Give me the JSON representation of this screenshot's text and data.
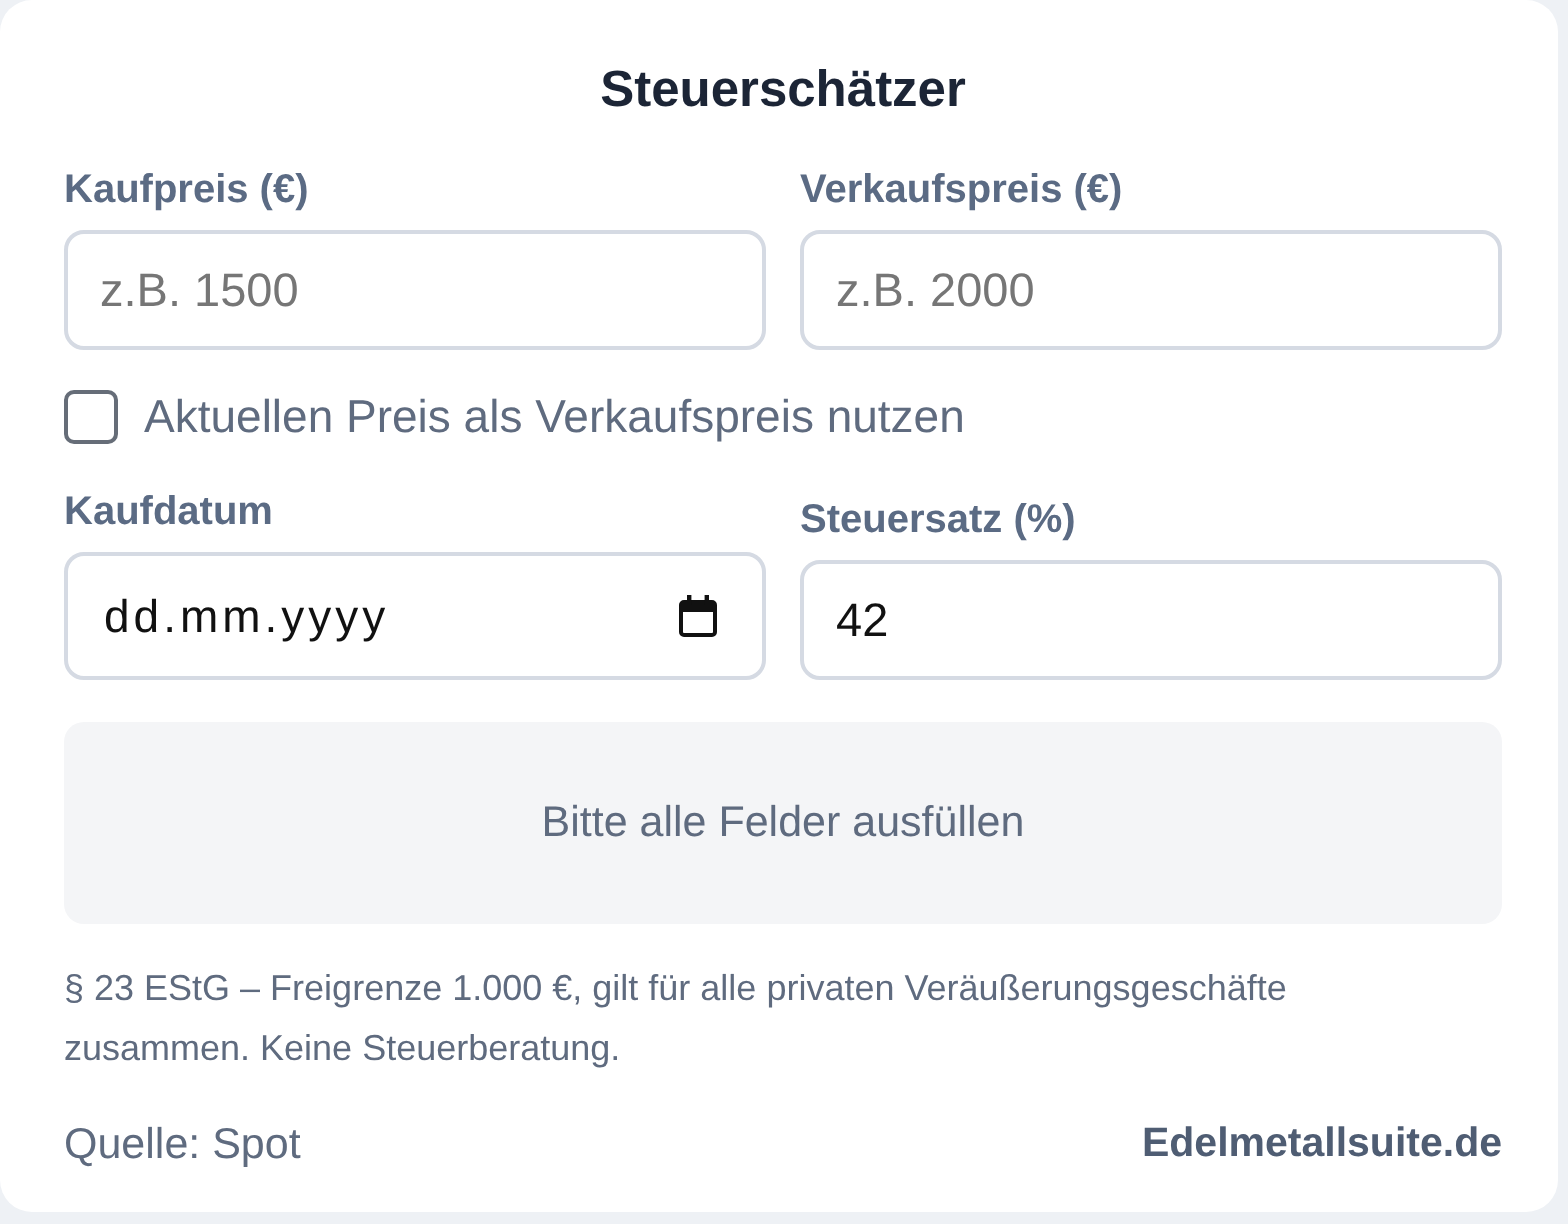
{
  "title": "Steuerschätzer",
  "fields": [
    {
      "label": "Kaufpreis (€)",
      "kind": "number",
      "placeholder": "z.B. 1500"
    },
    {
      "label": "Verkaufspreis (€)",
      "kind": "number",
      "placeholder": "z.B. 2000"
    }
  ],
  "checkbox": {
    "label": "Aktuellen Preis als Verkaufspreis nutzen",
    "checked": false
  },
  "fields_2": [
    {
      "label": "Kaufdatum",
      "kind": "date",
      "placeholder": "dd.mm.yyyy"
    },
    {
      "label": "Steuersatz (%)",
      "kind": "number",
      "value": "42"
    }
  ],
  "result": "Bitte alle Felder ausfüllen",
  "note": "§ 23 EStG – Freigrenze 1.000 €, gilt für alle privaten Veräußerungsgeschäfte zusammen. Keine Steuerberatung.",
  "footer": {
    "source": "Quelle: Spot",
    "brand": "Edelmetallsuite.de"
  }
}
